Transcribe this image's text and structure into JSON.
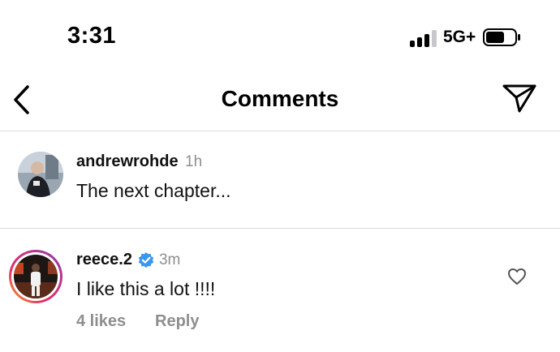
{
  "status_bar": {
    "time": "3:31",
    "network": "5G+",
    "signal_bars_active": 3,
    "signal_bars_total": 4,
    "battery_level": 0.6
  },
  "nav": {
    "back_icon": "chevron-left-icon",
    "title": "Comments",
    "share_icon": "paper-plane-icon"
  },
  "comments": [
    {
      "username": "andrewrohde",
      "time": "1h",
      "text": "The next chapter...",
      "verified": false
    },
    {
      "username": "reece.2",
      "time": "3m",
      "text": "I like this a lot !!!!",
      "verified": true,
      "has_story_ring": true,
      "likes": "4 likes",
      "reply_label": "Reply",
      "like_icon": "heart-outline-icon"
    }
  ],
  "colors": {
    "verified_blue": "#3897f0",
    "secondary_text": "#8e8e8e",
    "divider": "#dcdcdc"
  }
}
